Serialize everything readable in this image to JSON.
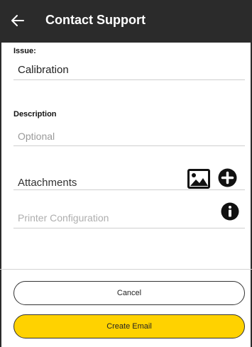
{
  "header": {
    "back_icon": "arrow-left-icon",
    "title": "Contact Support"
  },
  "form": {
    "issue": {
      "label": "Issue:",
      "value": "Calibration"
    },
    "description": {
      "label": "Description",
      "placeholder": "Optional"
    },
    "attachments": {
      "label": "Attachments",
      "image_icon": "image-icon",
      "add_icon": "add-circle-icon"
    },
    "printer_configuration": {
      "label": "Printer Configuration",
      "info_icon": "info-circle-icon"
    }
  },
  "actions": {
    "cancel_label": "Cancel",
    "create_label": "Create Email"
  },
  "colors": {
    "header_bg": "#2b2b2b",
    "accent": "#ffd200"
  }
}
